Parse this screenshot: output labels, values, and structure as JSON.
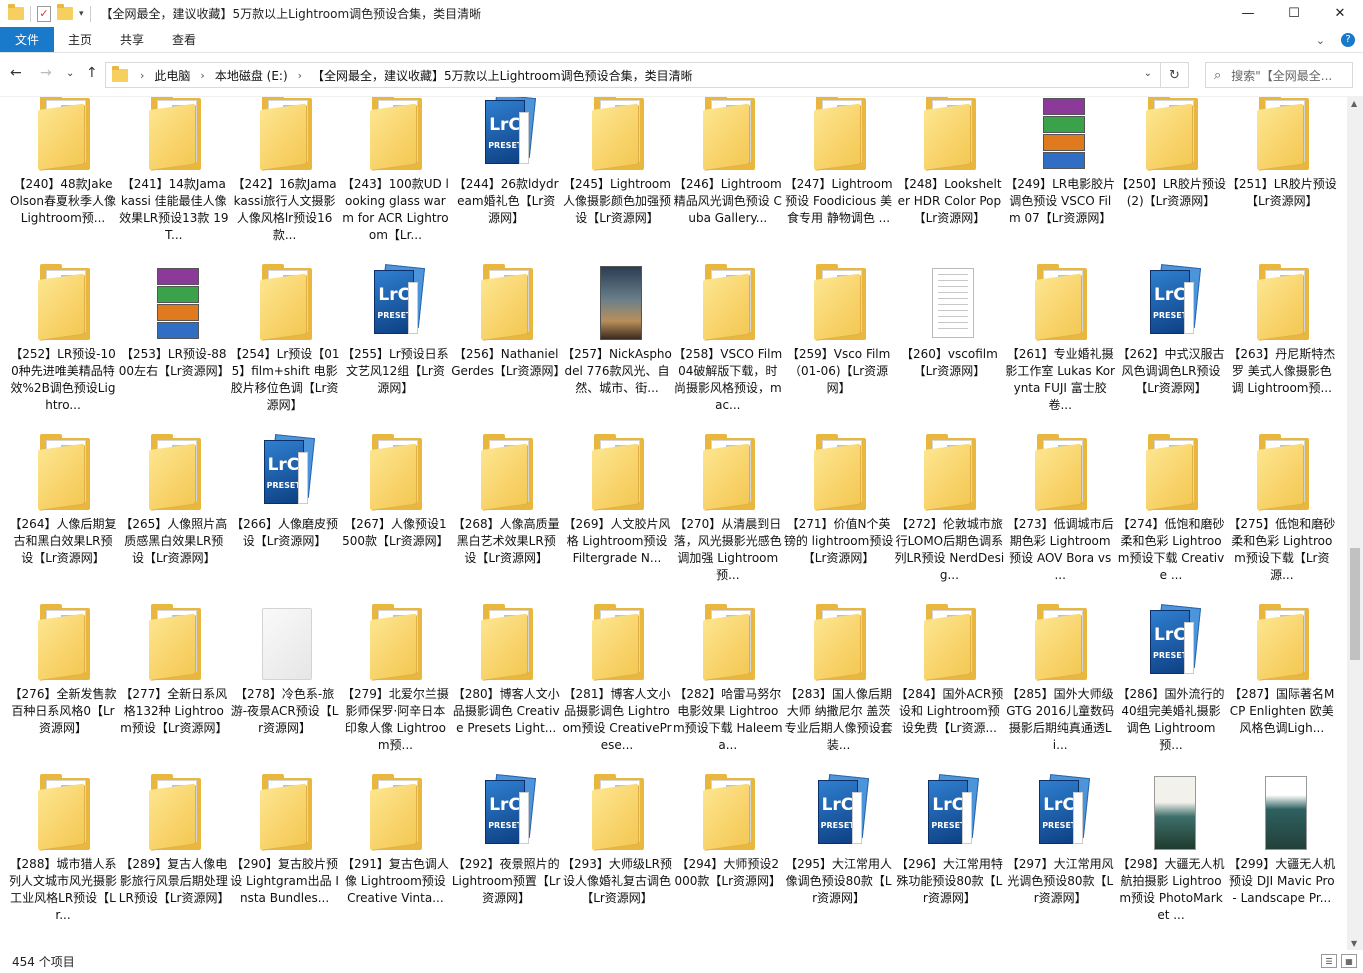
{
  "window": {
    "title": "【全网最全，建议收藏】5万款以上Lightroom调色预设合集，类目清晰",
    "minimize": "—",
    "maximize": "☐",
    "close": "✕"
  },
  "ribbon": {
    "tabs": [
      "文件",
      "主页",
      "共享",
      "查看"
    ],
    "expand_icon": "⌄",
    "help": "?"
  },
  "nav": {
    "back": "←",
    "forward": "→",
    "recent": "⌄",
    "up": "↑",
    "breadcrumb": [
      "此电脑",
      "本地磁盘 (E:)",
      "【全网最全，建议收藏】5万款以上Lightroom调色预设合集，类目清晰"
    ],
    "crumb_sep": "›",
    "refresh": "↻",
    "search_placeholder": "搜索\"【全网最全..."
  },
  "items": [
    {
      "label": "【240】48款Jake Olson春夏秋季人像Lightroom预...",
      "icon": "folder"
    },
    {
      "label": "【241】14款Jamakassi 佳能最佳人像效果LR预设13款 19T...",
      "icon": "folder"
    },
    {
      "label": "【242】16款Jamakassi旅行人文摄影人像风格lr预设16款...",
      "icon": "folder"
    },
    {
      "label": "【243】100款UD looking glass warm for ACR Lightroom【Lr...",
      "icon": "folder"
    },
    {
      "label": "【244】26款ldydream婚礼色【Lr资源网】",
      "icon": "lrc"
    },
    {
      "label": "【245】Lightroom人像摄影颜色加强预设【Lr资源网】",
      "icon": "folder"
    },
    {
      "label": "【246】Lightroom精品风光调色预设 Cuba Gallery...",
      "icon": "folder"
    },
    {
      "label": "【247】Lightroom预设 Foodicious 美食专用 静物调色 ...",
      "icon": "folder"
    },
    {
      "label": "【248】Lookshelter HDR Color Pop【Lr资源网】",
      "icon": "folder"
    },
    {
      "label": "【249】LR电影胶片调色预设 VSCO Film 07【Lr资源网】",
      "icon": "rar"
    },
    {
      "label": "【250】LR胶片预设(2)【Lr资源网】",
      "icon": "folder"
    },
    {
      "label": "【251】LR胶片预设【Lr资源网】",
      "icon": "folder"
    },
    {
      "label": "【252】LR预设-100种先进唯美精品特效%2B调色预设Lightro...",
      "icon": "folder"
    },
    {
      "label": "【253】LR预设-8800左右【Lr资源网】",
      "icon": "rar"
    },
    {
      "label": "【254】Lr预设【015】film+shift 电影胶片移位色调【Lr资源网】",
      "icon": "folder"
    },
    {
      "label": "【255】Lr预设日系文艺风12组【Lr资源网】",
      "icon": "lrc"
    },
    {
      "label": "【256】NathanielGerdes【Lr资源网】",
      "icon": "folder"
    },
    {
      "label": "【257】NickAsphodel 776款风光、自然、城市、街...",
      "icon": "photo"
    },
    {
      "label": "【258】VSCO Film 04破解版下载，时尚摄影风格预设，mac...",
      "icon": "folder"
    },
    {
      "label": "【259】Vsco Film （01-06)【Lr资源网】",
      "icon": "folder"
    },
    {
      "label": "【260】vscofilm【Lr资源网】",
      "icon": "doc"
    },
    {
      "label": "【261】专业婚礼摄影工作室 Lukas Korynta FUJI 富士胶卷...",
      "icon": "folder"
    },
    {
      "label": "【262】中式汉服古风色调调色LR预设【Lr资源网】",
      "icon": "lrc"
    },
    {
      "label": "【263】丹尼斯特杰罗 美式人像摄影色调 Lightroom预...",
      "icon": "folder"
    },
    {
      "label": "【264】人像后期复古和黑白效果LR预设【Lr资源网】",
      "icon": "folder"
    },
    {
      "label": "【265】人像照片高质感黑白效果LR预设【Lr资源网】",
      "icon": "folder"
    },
    {
      "label": "【266】人像磨皮预设【Lr资源网】",
      "icon": "lrc"
    },
    {
      "label": "【267】人像预设1500款【Lr资源网】",
      "icon": "folder"
    },
    {
      "label": "【268】人像高质量黑白艺术效果LR预设【Lr资源网】",
      "icon": "folder"
    },
    {
      "label": "【269】人文胶片风格 Lightroom预设 Filtergrade N...",
      "icon": "folder"
    },
    {
      "label": "【270】从清晨到日落，风光摄影光感色调加强 Lightroom预...",
      "icon": "folder"
    },
    {
      "label": "【271】价值N个英镑的 lightroom预设【Lr资源网】",
      "icon": "folder"
    },
    {
      "label": "【272】伦敦城市旅行LOMO后期色调系列LR预设 NerdDesig...",
      "icon": "folder"
    },
    {
      "label": "【273】低调城市后期色彩 Lightroom预设 AOV Bora vs ...",
      "icon": "folder"
    },
    {
      "label": "【274】低饱和磨砂柔和色彩 Lightroom预设下载 Creative ...",
      "icon": "folder"
    },
    {
      "label": "【275】低饱和磨砂柔和色彩 Lightroom预设下载【Lr资源...",
      "icon": "folder"
    },
    {
      "label": "【276】全新发售款百种日系风格0【Lr资源网】",
      "icon": "folder"
    },
    {
      "label": "【277】全新日系风格132种 Lightroom预设【Lr资源网】",
      "icon": "folder"
    },
    {
      "label": "【278】冷色系-旅游-夜景ACR预设【Lr资源网】",
      "icon": "ghost"
    },
    {
      "label": "【279】北爱尔兰摄影师保罗·阿辛日本印象人像 Lightroom预...",
      "icon": "folder"
    },
    {
      "label": "【280】博客人文小品摄影调色 Creative Presets Light...",
      "icon": "folder"
    },
    {
      "label": "【281】博客人文小品摄影调色 Lightroom预设 CreativePrese...",
      "icon": "folder"
    },
    {
      "label": "【282】哈雷马努尔 电影效果 Lightroom预设下载 Haleema...",
      "icon": "folder"
    },
    {
      "label": "【283】国人像后期大师 纳撒尼尔 盖茨 专业后期人像预设套装...",
      "icon": "folder"
    },
    {
      "label": "【284】国外ACR预设和 Lightroom预设免费【Lr资源...",
      "icon": "folder"
    },
    {
      "label": "【285】国外大师级GTG 2016儿童数码摄影后期纯真通透Li...",
      "icon": "folder"
    },
    {
      "label": "【286】国外流行的40组完美婚礼摄影调色 Lightroom预...",
      "icon": "lrc"
    },
    {
      "label": "【287】国际著名MCP Enlighten 欧美风格色调Ligh...",
      "icon": "folder"
    },
    {
      "label": "【288】城市猎人系列人文城市风光摄影工业风格LR预设【Lr...",
      "icon": "folder"
    },
    {
      "label": "【289】复古人像电影旅行风景后期处理LR预设【Lr资源网】",
      "icon": "folder"
    },
    {
      "label": "【290】复古胶片预设 Lightgram出品 Insta Bundles...",
      "icon": "folder"
    },
    {
      "label": "【291】复古色调人像 Lightroom预设 Creative Vinta...",
      "icon": "folder"
    },
    {
      "label": "【292】夜景照片的Lightroom预置【Lr资源网】",
      "icon": "lrc"
    },
    {
      "label": "【293】大师级LR预设人像婚礼复古调色【Lr资源网】",
      "icon": "folder"
    },
    {
      "label": "【294】大师预设2000款【Lr资源网】",
      "icon": "folder"
    },
    {
      "label": "【295】大江常用人像调色预设80款【Lr资源网】",
      "icon": "lrc"
    },
    {
      "label": "【296】大江常用特殊功能预设80款【Lr资源网】",
      "icon": "lrc"
    },
    {
      "label": "【297】大江常用风光调色预设80款【Lr资源网】",
      "icon": "lrc"
    },
    {
      "label": "【298】大疆无人机航拍摄影 Lightroom预设 PhotoMarket ...",
      "icon": "photo2"
    },
    {
      "label": "【299】大疆无人机预设 DJI Mavic Pro - Landscape Pr...",
      "icon": "photo3"
    }
  ],
  "status": {
    "count": "454 个项目"
  }
}
